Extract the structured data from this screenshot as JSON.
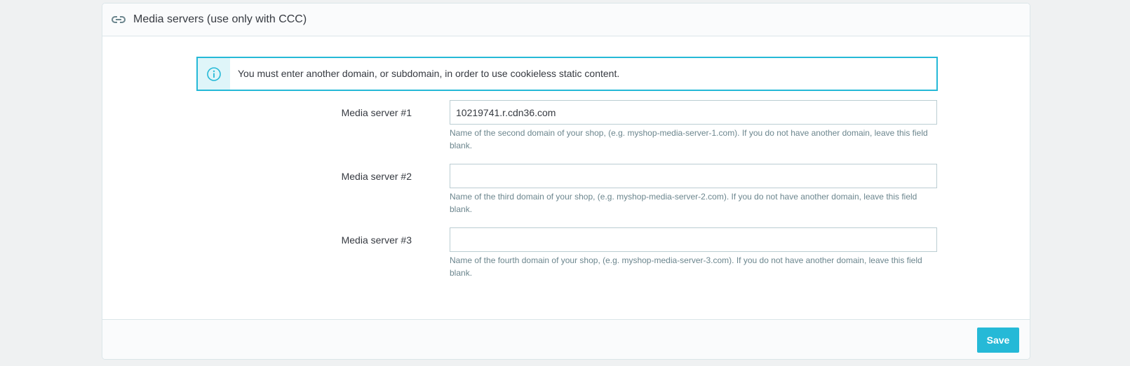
{
  "panel": {
    "title": "Media servers (use only with CCC)",
    "title_icon": "link-icon"
  },
  "alert": {
    "icon": "info-icon",
    "text": "You must enter another domain, or subdomain, in order to use cookieless static content."
  },
  "fields": [
    {
      "label": "Media server #1",
      "value": "10219741.r.cdn36.com",
      "help": "Name of the second domain of your shop, (e.g. myshop-media-server-1.com). If you do not have another domain, leave this field blank."
    },
    {
      "label": "Media server #2",
      "value": "",
      "help": "Name of the third domain of your shop, (e.g. myshop-media-server-2.com). If you do not have another domain, leave this field blank."
    },
    {
      "label": "Media server #3",
      "value": "",
      "help": "Name of the fourth domain of your shop, (e.g. myshop-media-server-3.com). If you do not have another domain, leave this field blank."
    }
  ],
  "footer": {
    "save_label": "Save"
  },
  "colors": {
    "accent": "#25b9d7",
    "background": "#eff1f2",
    "help_text": "#6c868e"
  }
}
